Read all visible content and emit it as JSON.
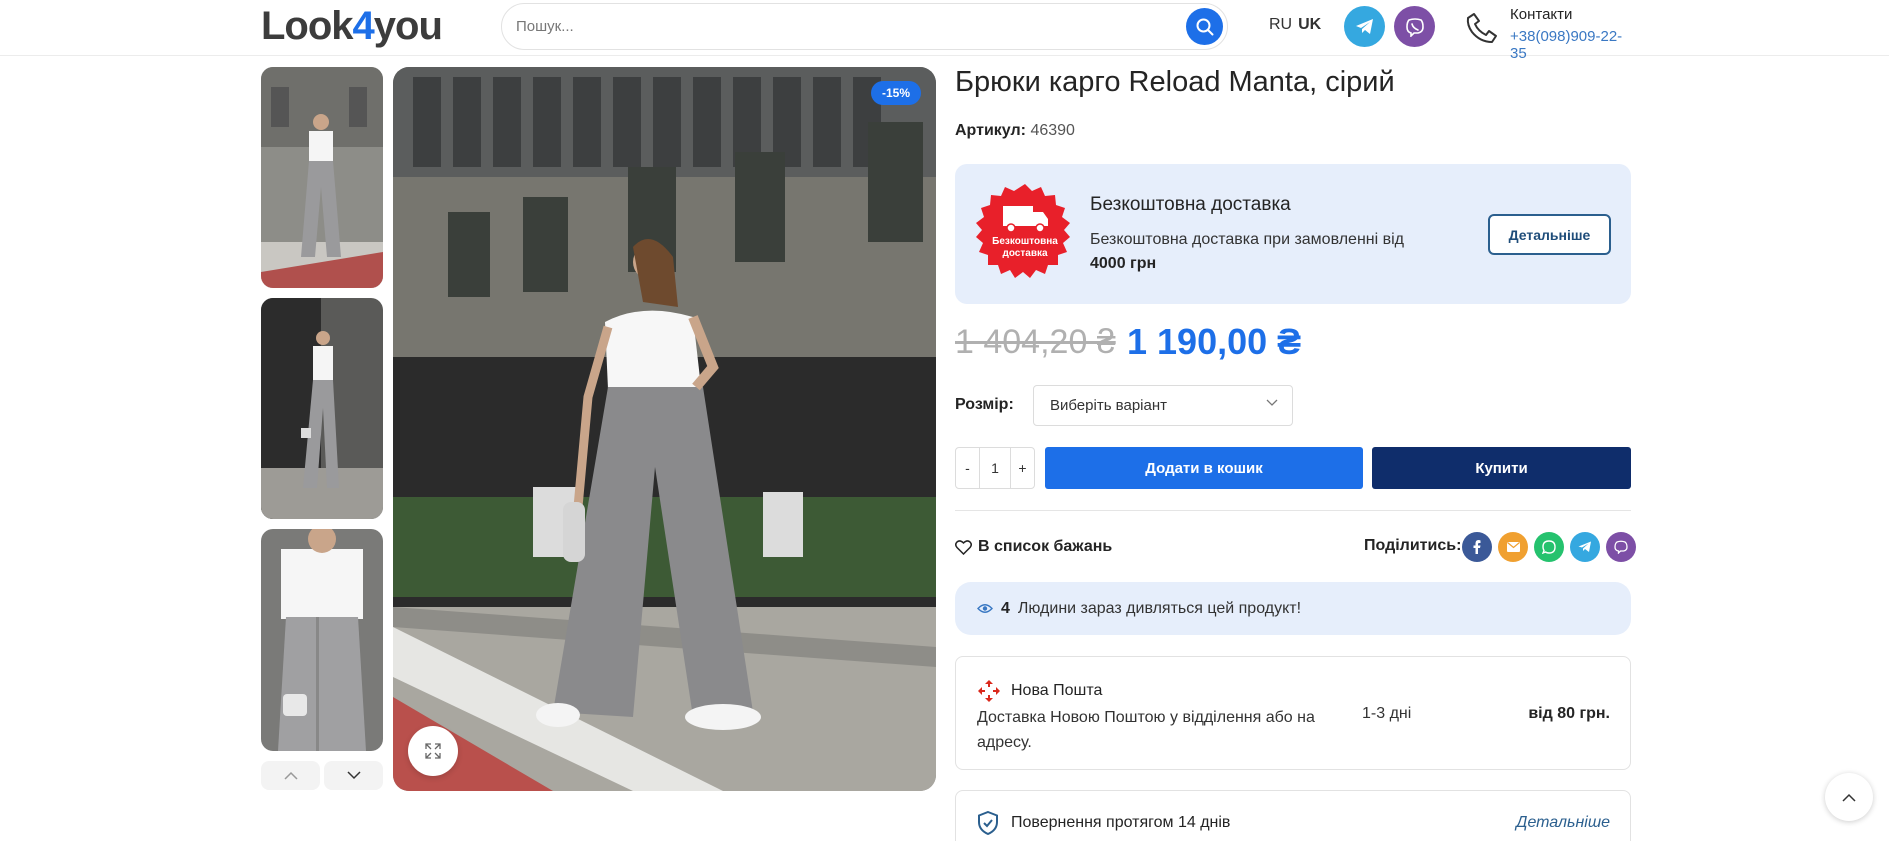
{
  "header": {
    "logo": {
      "part1": "Look",
      "part2": "4",
      "part3": "you"
    },
    "search": {
      "placeholder": "Пошук..."
    },
    "languages": [
      "RU",
      "UK"
    ],
    "active_language": "UK",
    "contacts": {
      "title": "Контакти",
      "phone": "+38(098)909-22-35"
    }
  },
  "gallery": {
    "sale_badge": "-15%"
  },
  "product": {
    "title": "Брюки карго Reload Manta, сірий",
    "sku_label": "Артикул:",
    "sku_value": "46390",
    "delivery": {
      "badge_text_1": "Безкоштовна",
      "badge_text_2": "доставка",
      "title": "Безкоштовна доставка",
      "text": "Безкоштовна доставка при замовленні від",
      "threshold": "4000 грн",
      "more_button": "Детальніше"
    },
    "price_old": "1 404,20 ₴",
    "price_new": "1 190,00 ₴",
    "size_label": "Розмір",
    "size_select": "Виберіть варіант",
    "quantity": {
      "minus": "-",
      "value": "1",
      "plus": "+"
    },
    "add_to_cart": "Додати в кошик",
    "buy": "Купити",
    "wishlist": "В список бажань",
    "share_label": "Поділитись:",
    "viewers_count": "4",
    "viewers_text": "Людини зараз дивляться цей продукт!",
    "shipping": {
      "name": "Нова Пошта",
      "description": "Доставка Новою Поштою у відділення або на адресу.",
      "days": "1-3 дні",
      "price": "від 80 грн."
    },
    "returns": {
      "text": "Повернення протягом 14 днів",
      "more": "Детальніше"
    }
  },
  "colors": {
    "accent": "#1d6fe8",
    "dark_button": "#0f2d6b",
    "light_panel": "#e6eefb",
    "telegram": "#35a8e0",
    "viber": "#7d4fa6",
    "facebook": "#3b5998",
    "email": "#f0a030",
    "whatsapp": "#25c26e"
  }
}
